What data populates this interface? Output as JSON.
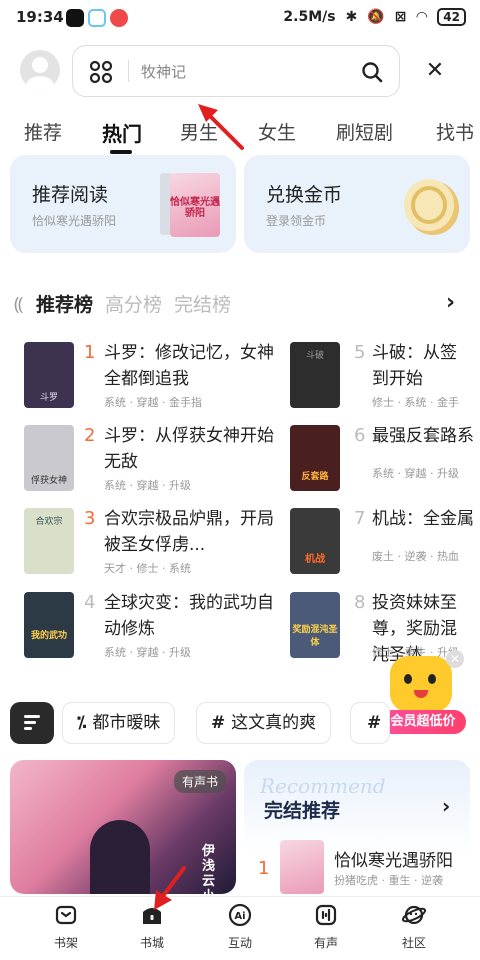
{
  "status": {
    "time": "19:34",
    "speed": "2.5M/s",
    "battery": "42"
  },
  "search": {
    "placeholder": "牧神记"
  },
  "tabs": [
    "推荐",
    "热门",
    "男生",
    "女生",
    "刷短剧",
    "找书"
  ],
  "cards": [
    {
      "title": "推荐阅读",
      "subtitle": "恰似寒光遇骄阳",
      "cover_text": "恰似寒光遇骄阳"
    },
    {
      "title": "兑换金币",
      "subtitle": "登录领金币"
    }
  ],
  "rank_tabs": [
    "推荐榜",
    "高分榜",
    "完结榜"
  ],
  "books": [
    {
      "num": "1",
      "title": "斗罗：修改记忆，女神全都倒追我",
      "tags": "系统 · 穿越 · 金手指",
      "cover": "#3d3350"
    },
    {
      "num": "2",
      "title": "斗罗：从俘获女神开始无敌",
      "tags": "系统 · 穿越 · 升级",
      "cover": "#c9c9cf"
    },
    {
      "num": "3",
      "title": "合欢宗极品炉鼎，开局被圣女俘虏...",
      "tags": "天才 · 修士 · 系统",
      "cover": "#d9dfc9"
    },
    {
      "num": "4",
      "title": "全球灾变：我的武功自动修炼",
      "tags": "系统 · 穿越 · 升级",
      "cover": "#2c3a45"
    },
    {
      "num": "5",
      "title": "斗破：从签到开始",
      "tags": "修士 · 系统 · 金手",
      "cover": "#2d2d2d"
    },
    {
      "num": "6",
      "title": "最强反套路系",
      "tags": "系统 · 穿越 · 升级",
      "cover": "#4a1f1f"
    },
    {
      "num": "7",
      "title": "机战：全金属",
      "tags": "废土 · 逆袭 · 热血",
      "cover": "#3a3a3a"
    },
    {
      "num": "8",
      "title": "投资妹妹至尊，奖励混沌圣体",
      "tags": "修士 · 重生 · 升级",
      "cover": "#4a5a78"
    }
  ],
  "book_cover_texts": [
    "斗罗",
    "俘获女神",
    "合欢宗",
    "我的武功",
    "斗破",
    "反套路",
    "机战",
    "奖励混沌圣体"
  ],
  "chips": [
    "都市暧昧",
    "这文真的爽",
    "#"
  ],
  "member_badge": "会员超低价",
  "promo": {
    "badge": "有声书",
    "side_text": "伊浅 云小爱"
  },
  "finish": {
    "watermark": "Recommend",
    "title": "完结推荐",
    "rank": "1",
    "book_title": "恰似寒光遇骄阳",
    "tags": "扮猪吃虎 · 重生 · 逆袭"
  },
  "nav": [
    {
      "label": "书架",
      "icon": "bookshelf-icon"
    },
    {
      "label": "书城",
      "icon": "bookstore-icon"
    },
    {
      "label": "互动",
      "icon": "ai-icon"
    },
    {
      "label": "有声",
      "icon": "audio-icon"
    },
    {
      "label": "社区",
      "icon": "community-icon"
    }
  ],
  "colors": {
    "accent": "#f26b3a",
    "card_bg": "#e9f1fa",
    "annotation": "#e02020"
  }
}
